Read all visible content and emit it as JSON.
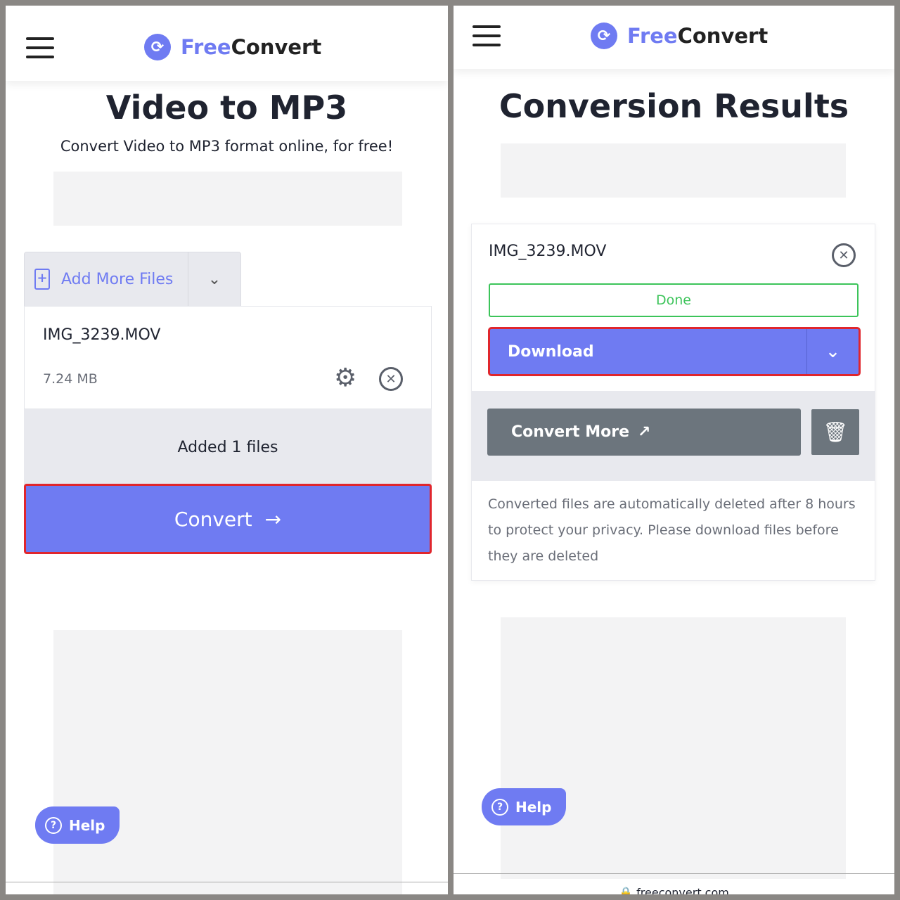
{
  "brand": {
    "free": "Free",
    "convert": "Convert"
  },
  "left": {
    "title": "Video to MP3",
    "subtitle": "Convert Video to MP3 format online, for free!",
    "add_more_files": "Add More Files",
    "file": {
      "name": "IMG_3239.MOV",
      "size": "7.24 MB"
    },
    "added_count": "Added 1 files",
    "convert_label": "Convert",
    "help": "Help"
  },
  "right": {
    "title": "Conversion Results",
    "file": {
      "name": "IMG_3239.MOV",
      "status": "Done"
    },
    "download_label": "Download",
    "convert_more_label": "Convert More",
    "notice": "Converted files are automatically deleted after 8 hours to protect your privacy. Please download files before they are deleted",
    "help": "Help",
    "url": "freeconvert.com"
  },
  "colors": {
    "accent": "#6f7bf2",
    "highlight": "#e0262d",
    "done": "#3cc45a",
    "secondary": "#6c757d"
  }
}
